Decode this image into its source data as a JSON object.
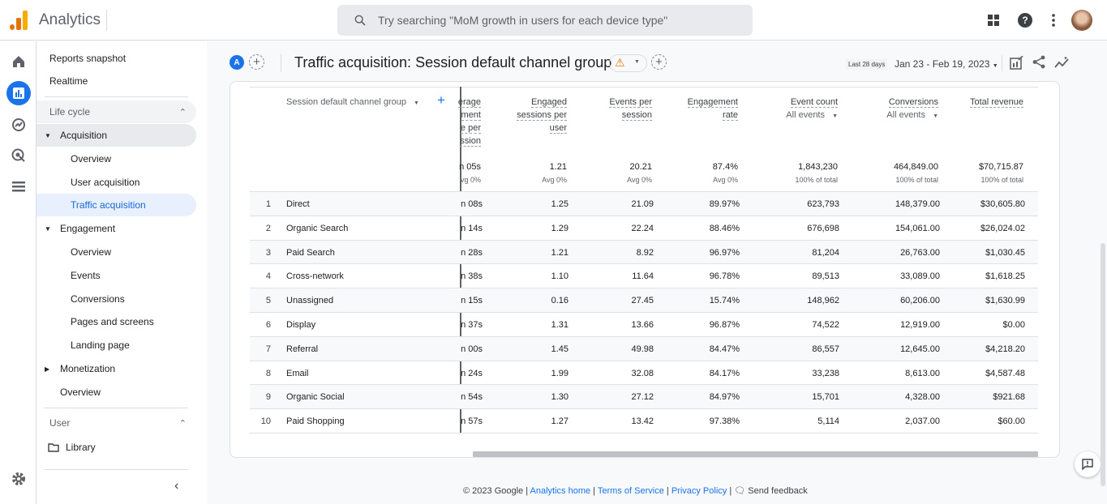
{
  "app": {
    "title": "Analytics",
    "search_placeholder": "Try searching \"MoM growth in users for each device type\""
  },
  "nav": {
    "reports_snapshot": "Reports snapshot",
    "realtime": "Realtime",
    "life_cycle": "Life cycle",
    "acquisition": "Acquisition",
    "acq_overview": "Overview",
    "user_acquisition": "User acquisition",
    "traffic_acquisition": "Traffic acquisition",
    "engagement": "Engagement",
    "eng_overview": "Overview",
    "events": "Events",
    "conversions": "Conversions",
    "pages_screens": "Pages and screens",
    "landing_page": "Landing page",
    "monetization": "Monetization",
    "mon_overview": "Overview",
    "user": "User",
    "library": "Library"
  },
  "header": {
    "avatar_letter": "A",
    "title": "Traffic acquisition: Session default channel group",
    "date_chip": "Last 28 days",
    "date_range": "Jan 23 - Feb 19, 2023"
  },
  "table": {
    "dimension_header": "Session default channel group",
    "columns": [
      {
        "label": [
          "erage",
          "ment",
          "e per",
          "ssion"
        ],
        "total": "n 05s",
        "sub": "vg 0%"
      },
      {
        "label": [
          "Engaged",
          "sessions per",
          "user"
        ],
        "total": "1.21",
        "sub": "Avg 0%"
      },
      {
        "label": [
          "Events per",
          "session"
        ],
        "total": "20.21",
        "sub": "Avg 0%"
      },
      {
        "label": [
          "Engagement",
          "rate"
        ],
        "total": "87.4%",
        "sub": "Avg 0%"
      },
      {
        "label": [
          "Event count"
        ],
        "dropdown": "All events",
        "total": "1,843,230",
        "sub": "100% of total"
      },
      {
        "label": [
          "Conversions"
        ],
        "dropdown": "All events",
        "total": "464,849.00",
        "sub": "100% of total"
      },
      {
        "label": [
          "Total revenue"
        ],
        "total": "$70,715.87",
        "sub": "100% of total"
      }
    ],
    "rows": [
      [
        "1",
        "Direct",
        "n 08s",
        "1.25",
        "21.09",
        "89.97%",
        "623,793",
        "148,379.00",
        "$30,605.80"
      ],
      [
        "2",
        "Organic Search",
        "n 14s",
        "1.29",
        "22.24",
        "88.46%",
        "676,698",
        "154,061.00",
        "$26,024.02"
      ],
      [
        "3",
        "Paid Search",
        "n 28s",
        "1.21",
        "8.92",
        "96.97%",
        "81,204",
        "26,763.00",
        "$1,030.45"
      ],
      [
        "4",
        "Cross-network",
        "n 38s",
        "1.10",
        "11.64",
        "96.78%",
        "89,513",
        "33,089.00",
        "$1,618.25"
      ],
      [
        "5",
        "Unassigned",
        "n 15s",
        "0.16",
        "27.45",
        "15.74%",
        "148,962",
        "60,206.00",
        "$1,630.99"
      ],
      [
        "6",
        "Display",
        "n 37s",
        "1.31",
        "13.66",
        "96.87%",
        "74,522",
        "12,919.00",
        "$0.00"
      ],
      [
        "7",
        "Referral",
        "n 00s",
        "1.45",
        "49.98",
        "84.47%",
        "86,557",
        "12,645.00",
        "$4,218.20"
      ],
      [
        "8",
        "Email",
        "n 24s",
        "1.99",
        "32.08",
        "84.17%",
        "33,238",
        "8,613.00",
        "$4,587.48"
      ],
      [
        "9",
        "Organic Social",
        "n 54s",
        "1.30",
        "27.12",
        "84.97%",
        "15,701",
        "4,328.00",
        "$921.68"
      ],
      [
        "10",
        "Paid Shopping",
        "n 57s",
        "1.27",
        "13.42",
        "97.38%",
        "5,114",
        "2,037.00",
        "$60.00"
      ]
    ]
  },
  "footer": {
    "copyright": "© 2023 Google |",
    "analytics_home": "Analytics home",
    "tos": "Terms of Service",
    "privacy": "Privacy Policy",
    "send_feedback": "Send feedback"
  },
  "colors": {
    "accent": "#1a73e8",
    "logo_orange": "#e37400",
    "logo_yellow": "#f9ab00"
  }
}
